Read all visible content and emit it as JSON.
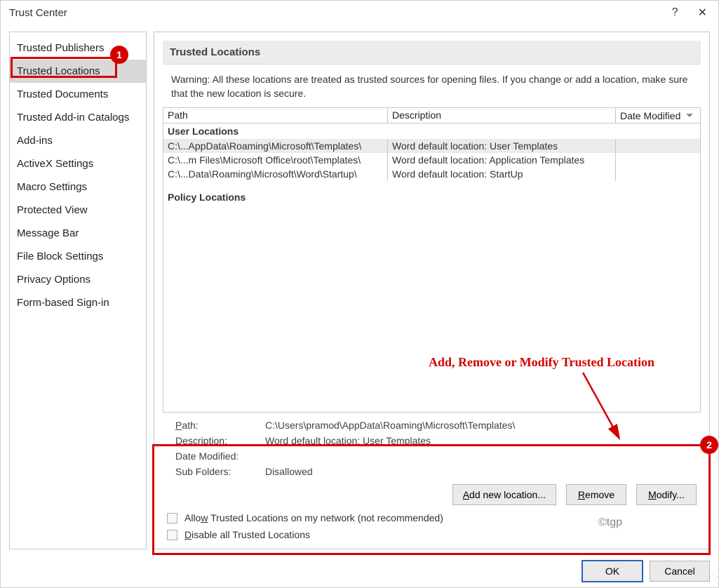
{
  "titlebar": {
    "title": "Trust Center"
  },
  "sidebar": {
    "items": [
      {
        "label": "Trusted Publishers",
        "selected": false
      },
      {
        "label": "Trusted Locations",
        "selected": true
      },
      {
        "label": "Trusted Documents",
        "selected": false
      },
      {
        "label": "Trusted Add-in Catalogs",
        "selected": false
      },
      {
        "label": "Add-ins",
        "selected": false
      },
      {
        "label": "ActiveX Settings",
        "selected": false
      },
      {
        "label": "Macro Settings",
        "selected": false
      },
      {
        "label": "Protected View",
        "selected": false
      },
      {
        "label": "Message Bar",
        "selected": false
      },
      {
        "label": "File Block Settings",
        "selected": false
      },
      {
        "label": "Privacy Options",
        "selected": false
      },
      {
        "label": "Form-based Sign-in",
        "selected": false
      }
    ]
  },
  "main": {
    "section_title": "Trusted Locations",
    "warning": "Warning: All these locations are treated as trusted sources for opening files.  If you change or add a location, make sure that the new location is secure.",
    "columns": {
      "path": "Path",
      "desc": "Description",
      "date": "Date Modified"
    },
    "groups": [
      {
        "title": "User Locations",
        "rows": [
          {
            "path": "C:\\...AppData\\Roaming\\Microsoft\\Templates\\",
            "desc": "Word default location: User Templates",
            "selected": true
          },
          {
            "path": "C:\\...m Files\\Microsoft Office\\root\\Templates\\",
            "desc": "Word default location: Application Templates",
            "selected": false
          },
          {
            "path": "C:\\...Data\\Roaming\\Microsoft\\Word\\Startup\\",
            "desc": "Word default location: StartUp",
            "selected": false
          }
        ]
      },
      {
        "title": "Policy Locations",
        "rows": []
      }
    ],
    "details": {
      "labels": {
        "path": "Path:",
        "desc": "Description:",
        "date": "Date Modified:",
        "sub": "Sub Folders:"
      },
      "path": "C:\\Users\\pramod\\AppData\\Roaming\\Microsoft\\Templates\\",
      "desc": "Word default location: User Templates",
      "date": "",
      "sub": "Disallowed"
    },
    "buttons": {
      "add": "Add new location...",
      "remove": "Remove",
      "modify": "Modify..."
    },
    "checks": {
      "network": "Allow Trusted Locations on my network (not recommended)",
      "disable": "Disable all Trusted Locations"
    }
  },
  "footer": {
    "ok": "OK",
    "cancel": "Cancel"
  },
  "watermark": "©tgp",
  "annotation": {
    "badge1": "1",
    "badge2": "2",
    "text": "Add, Remove or Modify Trusted Location"
  }
}
